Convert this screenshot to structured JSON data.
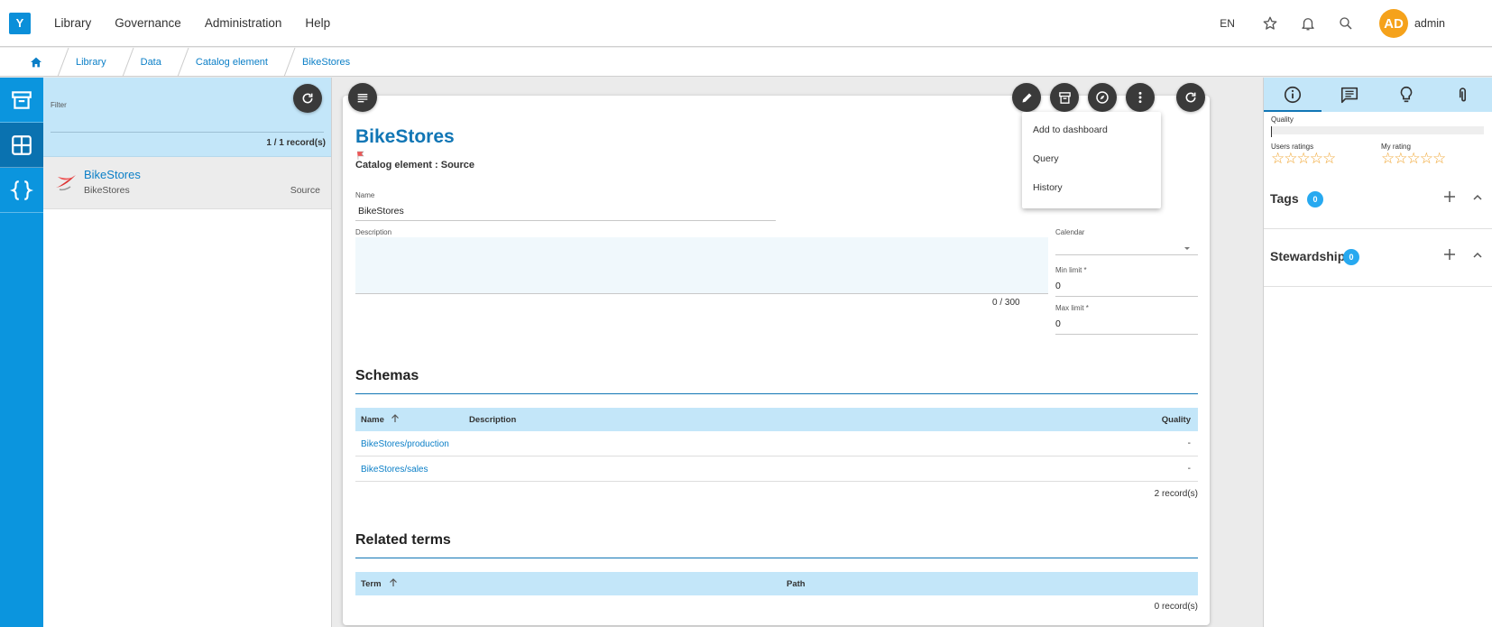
{
  "header": {
    "logo": "Y",
    "nav": [
      "Library",
      "Governance",
      "Administration",
      "Help"
    ],
    "lang": "EN",
    "avatar_initials": "AD",
    "user": "admin"
  },
  "breadcrumb": [
    "Library",
    "Data",
    "Catalog element",
    "BikeStores"
  ],
  "list": {
    "filter_label": "Filter",
    "record_count": "1 / 1 record(s)",
    "items": [
      {
        "title": "BikeStores",
        "subtitle": "BikeStores",
        "type": "Source"
      }
    ]
  },
  "detail": {
    "title": "BikeStores",
    "subtitle": "Catalog element : Source",
    "name_label": "Name",
    "name_value": "BikeStores",
    "description_label": "Description",
    "char_count": "0 / 300",
    "calendar_label": "Calendar",
    "min_label": "Min limit *",
    "min_value": "0",
    "max_label": "Max limit *",
    "max_value": "0"
  },
  "menu": [
    "Add to dashboard",
    "Query",
    "History"
  ],
  "schemas": {
    "title": "Schemas",
    "columns": [
      "Name",
      "Description",
      "Quality"
    ],
    "rows": [
      {
        "name": "BikeStores/production",
        "quality": "-"
      },
      {
        "name": "BikeStores/sales",
        "quality": "-"
      }
    ],
    "count": "2 record(s)"
  },
  "related": {
    "title": "Related terms",
    "columns": [
      "Term",
      "Path"
    ],
    "count": "0 record(s)"
  },
  "rightpanel": {
    "quality_label": "Quality",
    "users_ratings_label": "Users ratings",
    "my_rating_label": "My rating",
    "stars": "☆☆☆☆☆",
    "tags_label": "Tags",
    "tags_count": "0",
    "stewardship_label": "Stewardship",
    "stewardship_count": "0"
  },
  "colors": {
    "accent": "#0b95de",
    "link": "#0b7fc7",
    "highlight": "#c3e6f9",
    "avatar": "#f5a21b",
    "star": "#f0a32c"
  }
}
